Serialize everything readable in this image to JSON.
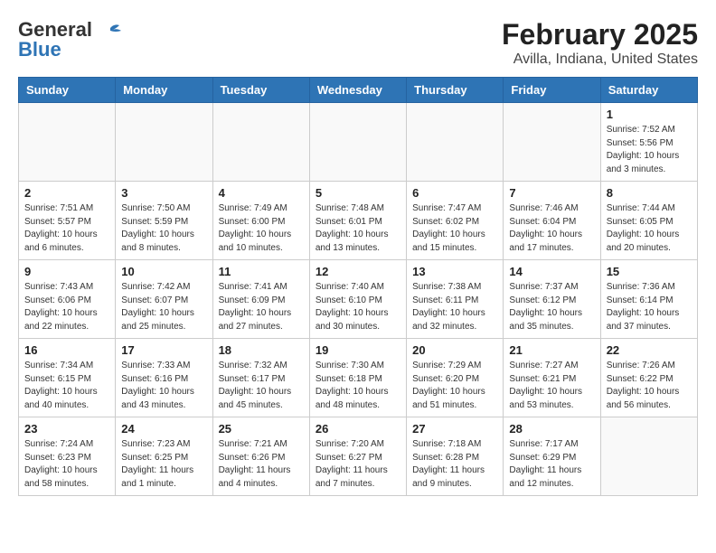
{
  "header": {
    "logo_line1": "General",
    "logo_line2": "Blue",
    "title": "February 2025",
    "subtitle": "Avilla, Indiana, United States"
  },
  "days_of_week": [
    "Sunday",
    "Monday",
    "Tuesday",
    "Wednesday",
    "Thursday",
    "Friday",
    "Saturday"
  ],
  "weeks": [
    [
      {
        "day": "",
        "info": ""
      },
      {
        "day": "",
        "info": ""
      },
      {
        "day": "",
        "info": ""
      },
      {
        "day": "",
        "info": ""
      },
      {
        "day": "",
        "info": ""
      },
      {
        "day": "",
        "info": ""
      },
      {
        "day": "1",
        "info": "Sunrise: 7:52 AM\nSunset: 5:56 PM\nDaylight: 10 hours and 3 minutes."
      }
    ],
    [
      {
        "day": "2",
        "info": "Sunrise: 7:51 AM\nSunset: 5:57 PM\nDaylight: 10 hours and 6 minutes."
      },
      {
        "day": "3",
        "info": "Sunrise: 7:50 AM\nSunset: 5:59 PM\nDaylight: 10 hours and 8 minutes."
      },
      {
        "day": "4",
        "info": "Sunrise: 7:49 AM\nSunset: 6:00 PM\nDaylight: 10 hours and 10 minutes."
      },
      {
        "day": "5",
        "info": "Sunrise: 7:48 AM\nSunset: 6:01 PM\nDaylight: 10 hours and 13 minutes."
      },
      {
        "day": "6",
        "info": "Sunrise: 7:47 AM\nSunset: 6:02 PM\nDaylight: 10 hours and 15 minutes."
      },
      {
        "day": "7",
        "info": "Sunrise: 7:46 AM\nSunset: 6:04 PM\nDaylight: 10 hours and 17 minutes."
      },
      {
        "day": "8",
        "info": "Sunrise: 7:44 AM\nSunset: 6:05 PM\nDaylight: 10 hours and 20 minutes."
      }
    ],
    [
      {
        "day": "9",
        "info": "Sunrise: 7:43 AM\nSunset: 6:06 PM\nDaylight: 10 hours and 22 minutes."
      },
      {
        "day": "10",
        "info": "Sunrise: 7:42 AM\nSunset: 6:07 PM\nDaylight: 10 hours and 25 minutes."
      },
      {
        "day": "11",
        "info": "Sunrise: 7:41 AM\nSunset: 6:09 PM\nDaylight: 10 hours and 27 minutes."
      },
      {
        "day": "12",
        "info": "Sunrise: 7:40 AM\nSunset: 6:10 PM\nDaylight: 10 hours and 30 minutes."
      },
      {
        "day": "13",
        "info": "Sunrise: 7:38 AM\nSunset: 6:11 PM\nDaylight: 10 hours and 32 minutes."
      },
      {
        "day": "14",
        "info": "Sunrise: 7:37 AM\nSunset: 6:12 PM\nDaylight: 10 hours and 35 minutes."
      },
      {
        "day": "15",
        "info": "Sunrise: 7:36 AM\nSunset: 6:14 PM\nDaylight: 10 hours and 37 minutes."
      }
    ],
    [
      {
        "day": "16",
        "info": "Sunrise: 7:34 AM\nSunset: 6:15 PM\nDaylight: 10 hours and 40 minutes."
      },
      {
        "day": "17",
        "info": "Sunrise: 7:33 AM\nSunset: 6:16 PM\nDaylight: 10 hours and 43 minutes."
      },
      {
        "day": "18",
        "info": "Sunrise: 7:32 AM\nSunset: 6:17 PM\nDaylight: 10 hours and 45 minutes."
      },
      {
        "day": "19",
        "info": "Sunrise: 7:30 AM\nSunset: 6:18 PM\nDaylight: 10 hours and 48 minutes."
      },
      {
        "day": "20",
        "info": "Sunrise: 7:29 AM\nSunset: 6:20 PM\nDaylight: 10 hours and 51 minutes."
      },
      {
        "day": "21",
        "info": "Sunrise: 7:27 AM\nSunset: 6:21 PM\nDaylight: 10 hours and 53 minutes."
      },
      {
        "day": "22",
        "info": "Sunrise: 7:26 AM\nSunset: 6:22 PM\nDaylight: 10 hours and 56 minutes."
      }
    ],
    [
      {
        "day": "23",
        "info": "Sunrise: 7:24 AM\nSunset: 6:23 PM\nDaylight: 10 hours and 58 minutes."
      },
      {
        "day": "24",
        "info": "Sunrise: 7:23 AM\nSunset: 6:25 PM\nDaylight: 11 hours and 1 minute."
      },
      {
        "day": "25",
        "info": "Sunrise: 7:21 AM\nSunset: 6:26 PM\nDaylight: 11 hours and 4 minutes."
      },
      {
        "day": "26",
        "info": "Sunrise: 7:20 AM\nSunset: 6:27 PM\nDaylight: 11 hours and 7 minutes."
      },
      {
        "day": "27",
        "info": "Sunrise: 7:18 AM\nSunset: 6:28 PM\nDaylight: 11 hours and 9 minutes."
      },
      {
        "day": "28",
        "info": "Sunrise: 7:17 AM\nSunset: 6:29 PM\nDaylight: 11 hours and 12 minutes."
      },
      {
        "day": "",
        "info": ""
      }
    ]
  ]
}
